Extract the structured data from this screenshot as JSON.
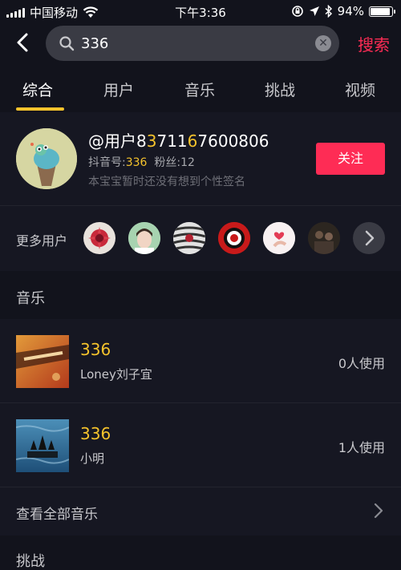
{
  "status_bar": {
    "carrier": "中国移动",
    "time": "下午3:36",
    "battery_text": "94%",
    "battery_level": 0.94
  },
  "search": {
    "query": "336",
    "submit_label": "搜索"
  },
  "tabs": [
    {
      "label": "综合",
      "active": true
    },
    {
      "label": "用户",
      "active": false
    },
    {
      "label": "音乐",
      "active": false
    },
    {
      "label": "挑战",
      "active": false
    },
    {
      "label": "视频",
      "active": false
    }
  ],
  "user": {
    "name_prefix": "@用户8",
    "name_hl1": "3",
    "name_mid": "711",
    "name_hl2": "6",
    "name_suffix": "7600806",
    "id_label": "抖音号:",
    "id_value": "336",
    "fans_label": "粉丝:",
    "fans_value": "12",
    "signature": "本宝宝暂时还没有想到个性签名",
    "follow_label": "关注"
  },
  "more_users": {
    "label": "更多用户",
    "avatars": [
      "flower-avatar",
      "boy-avatar",
      "stripes-avatar",
      "red-logo-avatar",
      "heart-avatar",
      "dark-photo-avatar"
    ]
  },
  "music_section": {
    "title": "音乐",
    "items": [
      {
        "title": "336",
        "artist": "Loney刘子宜",
        "usage": "0人使用"
      },
      {
        "title": "336",
        "artist": "小明",
        "usage": "1人使用"
      }
    ],
    "view_all_label": "查看全部音乐"
  },
  "challenge_section": {
    "title": "挑战"
  },
  "colors": {
    "accent_red": "#fe2c55",
    "highlight_yellow": "#f5c32c",
    "background": "#161722"
  }
}
